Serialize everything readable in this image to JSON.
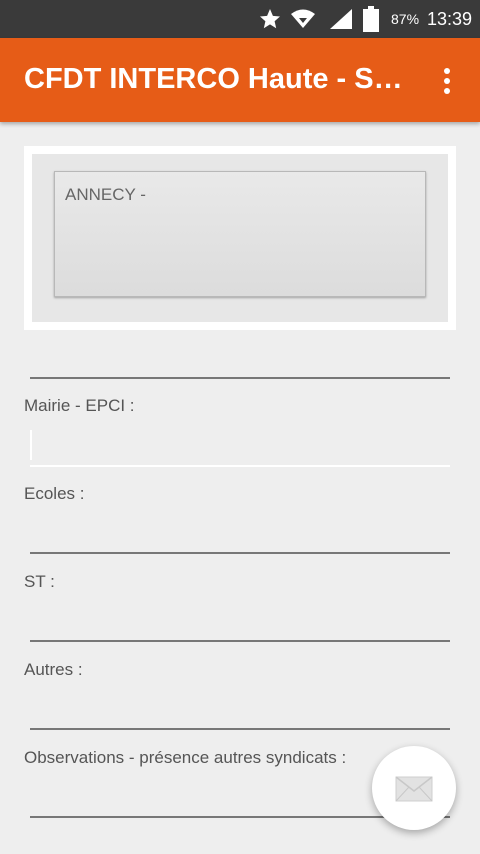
{
  "status_bar": {
    "battery_percent": "87%",
    "time": "13:39",
    "icons": [
      "star-icon",
      "wifi-icon",
      "signal-icon",
      "battery-icon"
    ]
  },
  "app_bar": {
    "title": "CFDT INTERCO Haute - Savoie",
    "menu_icon": "overflow-menu-icon",
    "color": "#e65c17"
  },
  "address_card": {
    "text": "ANNECY -"
  },
  "form": {
    "fields": [
      {
        "label": "Mairie - EPCI :"
      },
      {
        "label": "Ecoles :"
      },
      {
        "label": "ST :"
      },
      {
        "label": "Autres :"
      },
      {
        "label": "Observations - présence autres syndicats :"
      }
    ]
  },
  "fab": {
    "icon": "mail-icon"
  }
}
